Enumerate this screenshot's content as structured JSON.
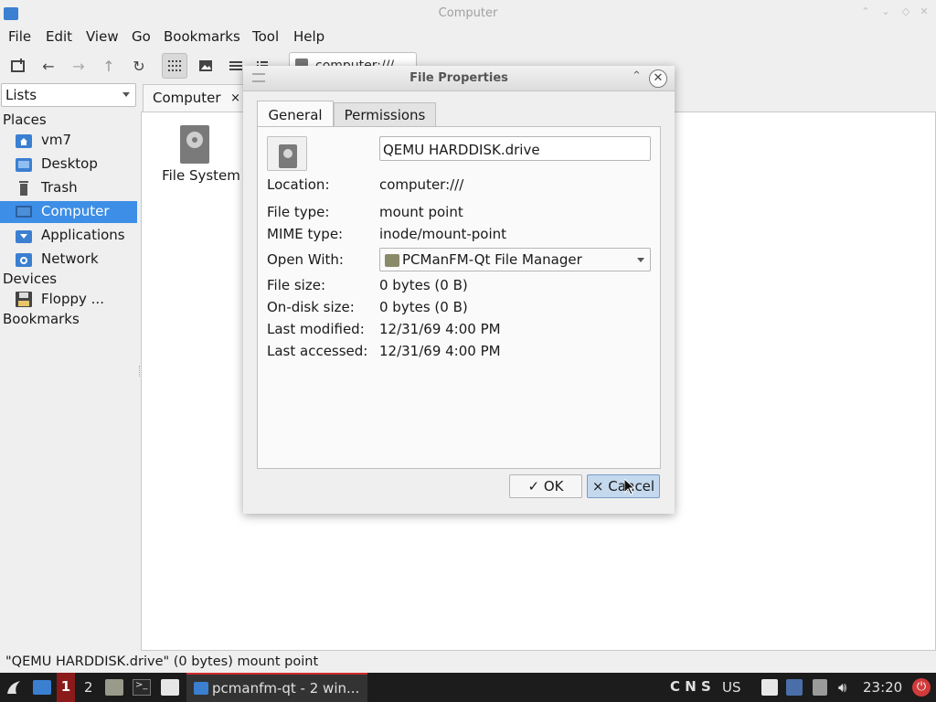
{
  "window": {
    "title": "Computer",
    "menu": [
      "File",
      "Edit",
      "View",
      "Go",
      "Bookmarks",
      "Tool",
      "Help"
    ],
    "path": "computer:///"
  },
  "sidebar": {
    "mode": "Lists",
    "places_label": "Places",
    "places": [
      "vm7",
      "Desktop",
      "Trash",
      "Computer",
      "Applications",
      "Network"
    ],
    "devices_label": "Devices",
    "devices": [
      "Floppy ..."
    ],
    "bookmarks_label": "Bookmarks"
  },
  "tabs": {
    "current": "Computer",
    "close": "×"
  },
  "content": {
    "items": [
      "File System"
    ]
  },
  "status": "\"QEMU HARDDISK.drive\" (0 bytes) mount point",
  "dialog": {
    "title": "File Properties",
    "tabs": [
      "General",
      "Permissions"
    ],
    "name_value": "QEMU HARDDISK.drive",
    "labels": {
      "location": "Location:",
      "file_type": "File type:",
      "mime_type": "MIME type:",
      "open_with": "Open With:",
      "file_size": "File size:",
      "on_disk_size": "On-disk size:",
      "last_modified": "Last modified:",
      "last_accessed": "Last accessed:"
    },
    "values": {
      "location": "computer:///",
      "file_type": "mount point",
      "mime_type": "inode/mount-point",
      "open_with": "PCManFM-Qt File Manager",
      "file_size": "0 bytes (0 B)",
      "on_disk_size": "0 bytes (0 B)",
      "last_modified": "12/31/69 4:00 PM",
      "last_accessed": "12/31/69 4:00 PM"
    },
    "ok_label": "OK",
    "cancel_label": "Cancel"
  },
  "taskbar": {
    "workspaces": [
      "1",
      "2"
    ],
    "task_label": "pcmanfm-qt - 2 win...",
    "indicators": "C N S",
    "keyboard": "US",
    "clock": "23:20"
  },
  "colors": {
    "selection": "#3d8ee6",
    "taskbar": "#1c1c1c",
    "active_workspace": "#8b1a1a"
  }
}
